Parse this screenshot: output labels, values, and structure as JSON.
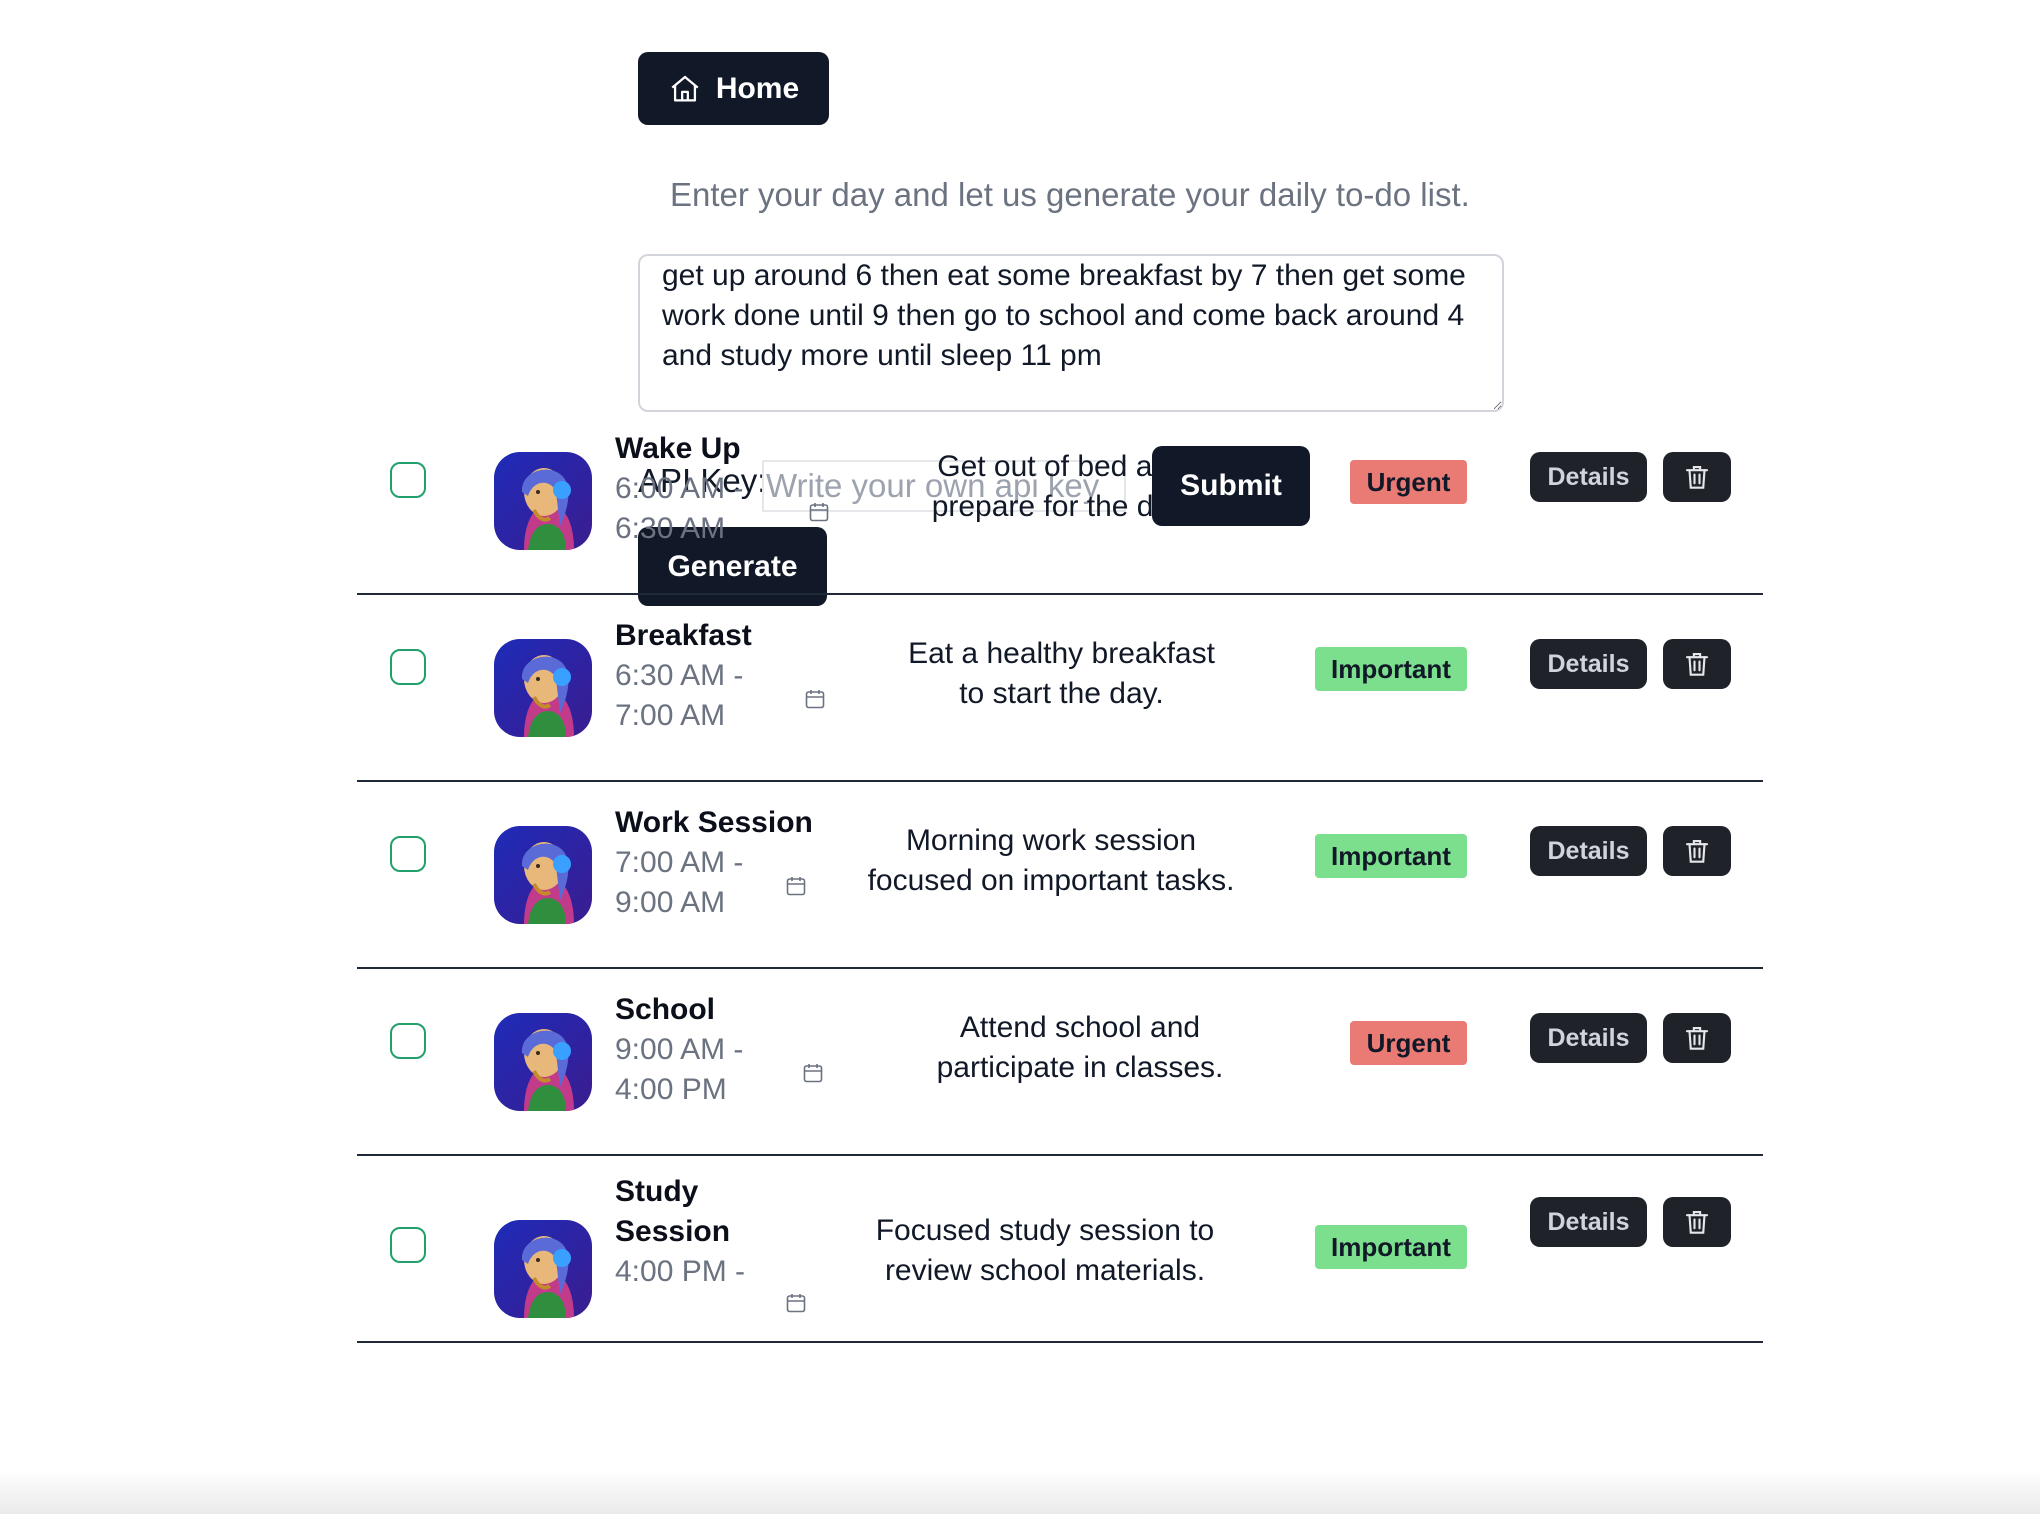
{
  "nav": {
    "home_label": "Home",
    "home_icon": "home-icon"
  },
  "instruction": "Enter your day and let us generate your daily to-do list.",
  "day_input": {
    "value": "get up around 6 then eat some breakfast by 7 then get some work done until 9 then go to school and come back around 4 and study more until sleep 11 pm"
  },
  "api": {
    "label": "API Key:",
    "placeholder": "Write your own api key",
    "value": ""
  },
  "buttons": {
    "submit": "Submit",
    "generate": "Generate"
  },
  "tasks": [
    {
      "title": "Wake Up",
      "time_start": "6:00 AM -",
      "time_end": "6:30 AM",
      "description": "Get out of bed and prepare for the day.",
      "priority": "Urgent",
      "details": "Details"
    },
    {
      "title": "Breakfast",
      "time_start": "6:30 AM -",
      "time_end": "7:00 AM",
      "description": "Eat a healthy breakfast to start the day.",
      "priority": "Important",
      "details": "Details"
    },
    {
      "title": "Work Session",
      "time_start": "7:00 AM -",
      "time_end": "9:00 AM",
      "description": "Morning work session focused on important tasks.",
      "priority": "Important",
      "details": "Details"
    },
    {
      "title": "School",
      "time_start": "9:00 AM -",
      "time_end": "4:00 PM",
      "description": "Attend school and participate in classes.",
      "priority": "Urgent",
      "details": "Details"
    },
    {
      "title": "Study Session",
      "time_start": "4:00 PM -",
      "time_end": "",
      "description": "Focused study session to review school materials.",
      "priority": "Important",
      "details": "Details"
    }
  ],
  "colors": {
    "dark": "#111827",
    "urgent": "#ea7a74",
    "important": "#7bdf8d",
    "checkbox": "#22a06b"
  }
}
